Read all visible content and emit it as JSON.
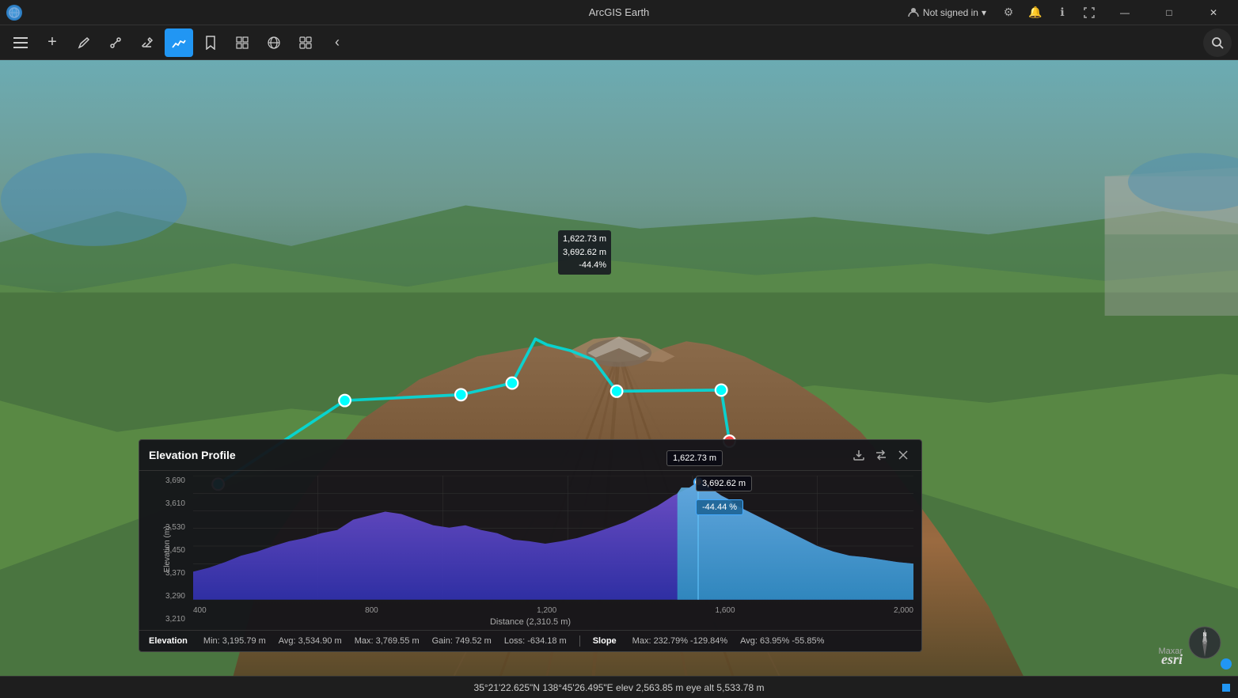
{
  "app": {
    "title": "ArcGIS Earth"
  },
  "titlebar": {
    "app_icon": "🌐",
    "not_signed_in": "Not signed in",
    "settings_icon": "⚙",
    "notifications_icon": "🔔",
    "info_icon": "ℹ",
    "fullscreen_icon": "⛶",
    "minimize": "—",
    "maximize": "□",
    "close": "✕"
  },
  "toolbar": {
    "menu_icon": "☰",
    "add_icon": "+",
    "draw_icon": "✏",
    "measure_icon": "📎",
    "erase_icon": "◻",
    "elevation_icon": "📈",
    "bookmark_icon": "🔖",
    "view_icon": "⊞",
    "globe_icon": "🌐",
    "grid_icon": "⊞",
    "collapse_icon": "‹",
    "search_icon": "🔍"
  },
  "map": {
    "annotations": [
      {
        "label": "1,622.73 m",
        "sub1": "3,692.62 m",
        "sub2": "-44.4%",
        "top": "220",
        "left": "710"
      }
    ],
    "dots": [
      {
        "top": "293",
        "left": "546",
        "type": "cyan"
      },
      {
        "top": "288",
        "left": "646",
        "type": "cyan"
      },
      {
        "top": "278",
        "left": "690",
        "type": "cyan"
      },
      {
        "top": "284",
        "left": "780",
        "type": "cyan"
      },
      {
        "top": "284",
        "left": "870",
        "type": "cyan"
      },
      {
        "top": "328",
        "left": "877",
        "type": "red"
      },
      {
        "top": "365",
        "left": "437",
        "type": "cyan"
      }
    ]
  },
  "elevation_profile": {
    "title": "Elevation Profile",
    "export_icon": "↗",
    "swap_icon": "⇄",
    "close_icon": "✕",
    "tooltip_distance": "1,622.73 m",
    "tooltip_elevation": "3,692.62 m",
    "tooltip_slope": "-44.44 %",
    "y_axis_title": "Elevation (m)",
    "x_axis_title": "Distance (2,310.5  m)",
    "y_labels": [
      "3,690",
      "3,610",
      "3,530",
      "3,450",
      "3,370",
      "3,290",
      "3,210"
    ],
    "x_labels": [
      "400",
      "800",
      "1,200",
      "1,600",
      "2,000"
    ],
    "stats": {
      "elevation_label": "Elevation",
      "min": "Min: 3,195.79 m",
      "avg": "Avg: 3,534.90 m",
      "max": "Max: 3,769.55 m",
      "gain": "Gain: 749.52 m",
      "loss": "Loss: -634.18 m",
      "slope_label": "Slope",
      "slope_max": "Max: 232.79% -129.84%",
      "slope_avg": "Avg: 63.95% -55.85%"
    }
  },
  "statusbar": {
    "coords": "35°21'22.625\"N 138°45'26.495\"E  elev 2,563.85 m  eye alt 5,533.78 m"
  },
  "credits": {
    "maxar": "Maxar",
    "esri": "esri"
  }
}
